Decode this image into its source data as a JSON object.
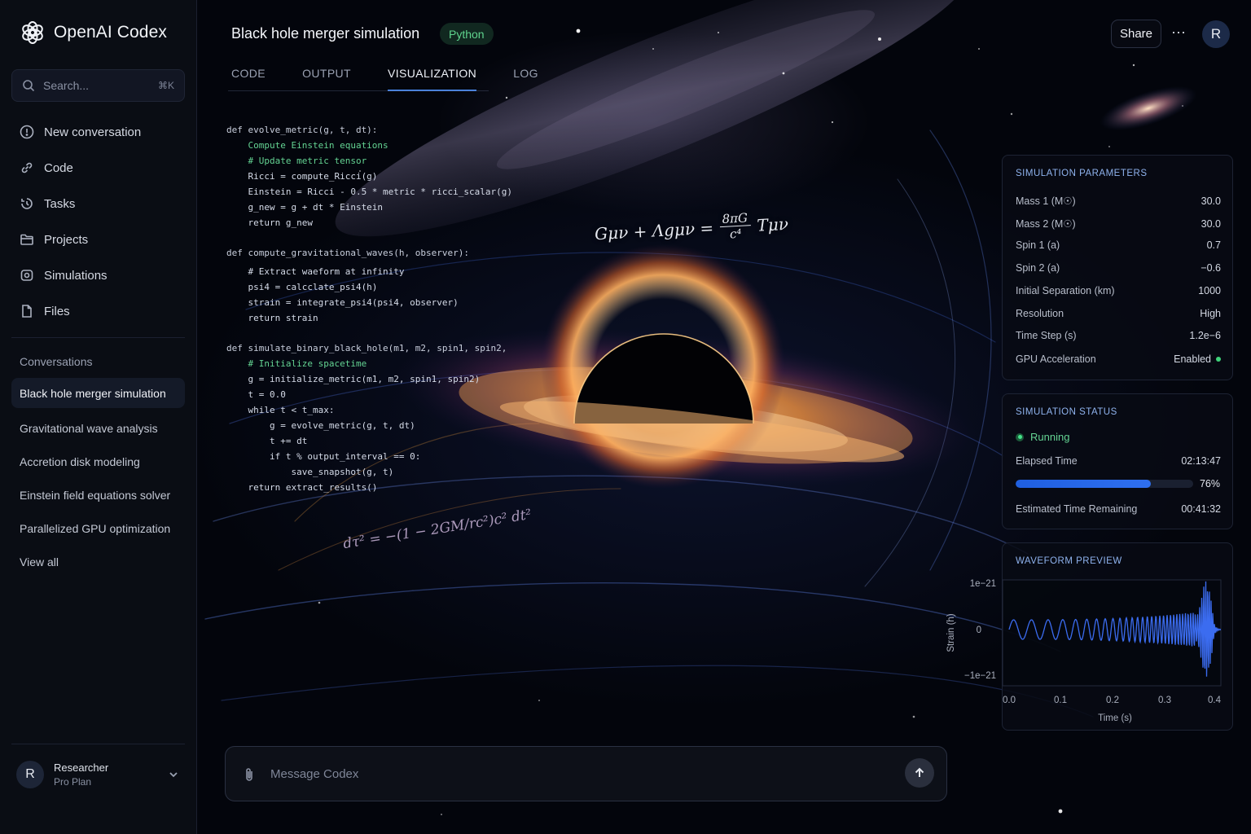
{
  "brand": {
    "name": "OpenAI Codex"
  },
  "search": {
    "placeholder": "Search...",
    "shortcut": "⌘K"
  },
  "nav": [
    {
      "label": "New conversation",
      "icon": "new-conversation-icon"
    },
    {
      "label": "Code",
      "icon": "link-icon"
    },
    {
      "label": "Tasks",
      "icon": "tasks-icon"
    },
    {
      "label": "Projects",
      "icon": "folder-icon"
    },
    {
      "label": "Simulations",
      "icon": "simulation-icon"
    },
    {
      "label": "Files",
      "icon": "file-icon"
    }
  ],
  "conversations": {
    "heading": "Conversations",
    "items": [
      "Black hole merger simulation",
      "Gravitational wave analysis",
      "Accretion disk modeling",
      "Einstein field equations solver",
      "Parallelized GPU optimization",
      "View all"
    ]
  },
  "user": {
    "initial": "R",
    "name": "Researcher",
    "plan": "Pro Plan"
  },
  "header": {
    "title": "Black hole merger simulation",
    "language": "Python",
    "tabs": [
      "CODE",
      "OUTPUT",
      "VISUALIZATION",
      "LOG"
    ],
    "active_tab": "VISUALIZATION",
    "share_label": "Share",
    "more_label": "···",
    "avatar_initial": "R"
  },
  "code_lines": [
    "def evolve_metric(g, t, dt):",
    "    Compute Einstein equations",
    "    # Update metric tensor",
    "    Ricci = compute_Ricci(g)",
    "    Einstein = Ricci - 0.5 * metric * ricci_scalar(g)",
    "    g_new = g + dt * Einstein",
    "    return g_new",
    "def compute_gravitational_waves(h, observer):",
    "    # Extract waeform at infinity",
    "    psi4 = calcclate_psi4(h)",
    "    strain = integrate_psi4(psi4, observer)",
    "    return strain",
    "def simulate_binary_black_hole(m1, m2, spin1, spin2,",
    "    # Initialize spacetime",
    "    g = initialize_metric(m1, m2, spin1, spin2)",
    "    t = 0.0",
    "    while t < t_max:",
    "        g = evolve_metric(g, t, dt)",
    "        t += dt",
    "        if t % output_interval == 0:",
    "            save_snapshot(g, t)",
    "    return extract_results()"
  ],
  "equation": {
    "lhs": "Gμν + Λgμν =",
    "numerator": "8πG",
    "denominator": "c⁴",
    "rhs": "Tμν",
    "metric_fragment": "dτ² = −(1 − 2GM/rc²)c² dt²"
  },
  "simulation_parameters": {
    "title": "SIMULATION PARAMETERS",
    "rows": [
      {
        "label": "Mass 1 (M☉)",
        "value": "30.0"
      },
      {
        "label": "Mass 2 (M☉)",
        "value": "30.0"
      },
      {
        "label": "Spin 1 (a)",
        "value": "0.7"
      },
      {
        "label": "Spin 2 (a)",
        "value": "−0.6"
      },
      {
        "label": "Initial Separation (km)",
        "value": "1000"
      },
      {
        "label": "Resolution",
        "value": "High"
      },
      {
        "label": "Time Step (s)",
        "value": "1.2e−6"
      },
      {
        "label": "GPU Acceleration",
        "value": "Enabled"
      }
    ]
  },
  "simulation_status": {
    "title": "SIMULATION STATUS",
    "state": "Running",
    "elapsed_label": "Elapsed Time",
    "elapsed_value": "02:13:47",
    "progress": 0.76,
    "progress_label": "76%",
    "remaining_label": "Estimated Time Remaining",
    "remaining_value": "00:41:32"
  },
  "waveform": {
    "title": "WAVEFORM PREVIEW",
    "y_ticks": [
      "1e−21",
      "0",
      "−1e−21"
    ],
    "x_ticks": [
      "0.0",
      "0.1",
      "0.2",
      "0.3",
      "0.4"
    ],
    "ylabel": "Strain (h)",
    "xlabel": "Time (s)",
    "color": "#3b6cf0"
  },
  "composer": {
    "placeholder": "Message Codex"
  },
  "colors": {
    "accent": "#4a8df5",
    "success": "#45e38a",
    "progress": "#2f70f0"
  }
}
